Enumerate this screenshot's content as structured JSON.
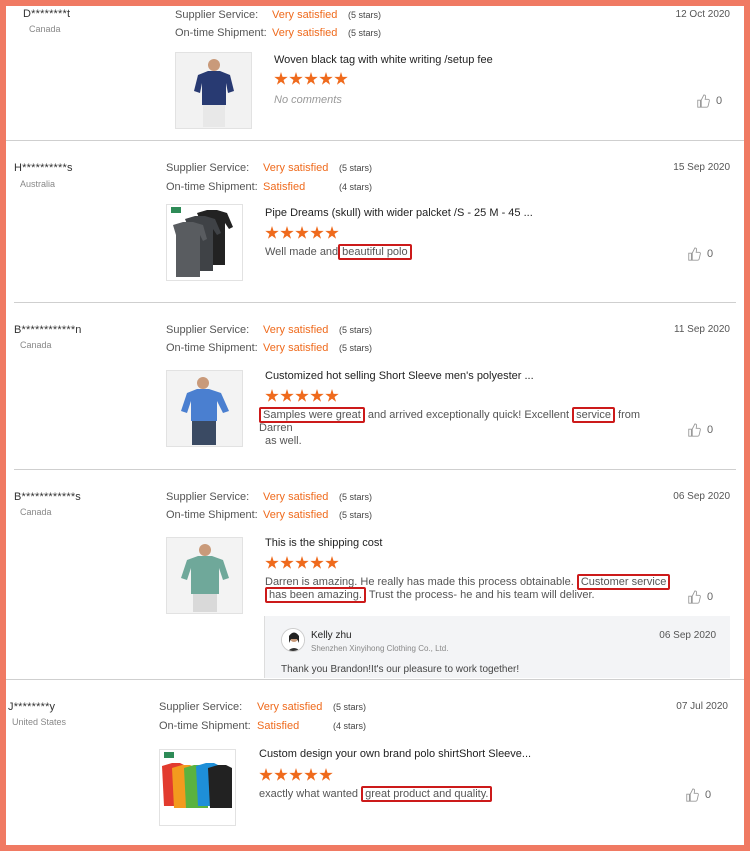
{
  "labels": {
    "supplier_service": "Supplier Service:",
    "ontime_shipment": "On-time Shipment:"
  },
  "reviews": [
    {
      "name": "D********t",
      "country": "Canada",
      "date": "12 Oct 2020",
      "supplier_value": "Very satisfied",
      "supplier_stars": "(5 stars)",
      "shipment_value": "Very satisfied",
      "shipment_stars": "(5 stars)",
      "product_title": "Woven black tag with white writing /setup fee",
      "rating": 5,
      "comment_parts": [
        "No comments"
      ],
      "likes": "0"
    },
    {
      "name": "H**********s",
      "country": "Australia",
      "date": "15 Sep 2020",
      "supplier_value": "Very satisfied",
      "supplier_stars": "(5 stars)",
      "shipment_value": "Satisfied",
      "shipment_stars": "(4 stars)",
      "product_title": "Pipe Dreams (skull) with wider palcket /S - 25 M - 45 ...",
      "rating": 5,
      "comment_parts": [
        "Well made and",
        "beautiful polo"
      ],
      "likes": "0"
    },
    {
      "name": "B************n",
      "country": "Canada",
      "date": "11 Sep 2020",
      "supplier_value": "Very satisfied",
      "supplier_stars": "(5 stars)",
      "shipment_value": "Very satisfied",
      "shipment_stars": "(5 stars)",
      "product_title": "Customized hot selling Short Sleeve men's polyester ...",
      "rating": 5,
      "comment_parts": [
        "Samples were great",
        "and arrived exceptionally quick! Excellent",
        "service",
        "from Darren",
        "as well."
      ],
      "likes": "0"
    },
    {
      "name": "B************s",
      "country": "Canada",
      "date": "06 Sep 2020",
      "supplier_value": "Very satisfied",
      "supplier_stars": "(5 stars)",
      "shipment_value": "Very satisfied",
      "shipment_stars": "(5 stars)",
      "product_title": "This is the shipping cost",
      "rating": 5,
      "comment_parts": [
        "Darren is amazing. He really has made this process obtainable.",
        "Customer service",
        "has been amazing.",
        "Trust the process- he and his team will deliver."
      ],
      "likes": "0",
      "reply": {
        "name": "Kelly zhu",
        "company": "Shenzhen Xinyihong Clothing Co., Ltd.",
        "date": "06 Sep 2020",
        "text": "Thank you Brandon!It's our pleasure to work together!"
      }
    },
    {
      "name": "J********y",
      "country": "United States",
      "date": "07 Jul 2020",
      "supplier_value": "Very satisfied",
      "supplier_stars": "(5 stars)",
      "shipment_value": "Satisfied",
      "shipment_stars": "(4 stars)",
      "product_title": "Custom design your own brand polo shirtShort Sleeve...",
      "rating": 5,
      "comment_parts": [
        "exactly what wanted",
        "great product and quality."
      ],
      "likes": "0"
    }
  ],
  "colors": {
    "accent": "#ef6a1c",
    "highlight_box": "#cc1a1a",
    "frame": "#f07a63"
  },
  "icons": {
    "like": "thumbs-up-icon",
    "star": "star-icon"
  }
}
